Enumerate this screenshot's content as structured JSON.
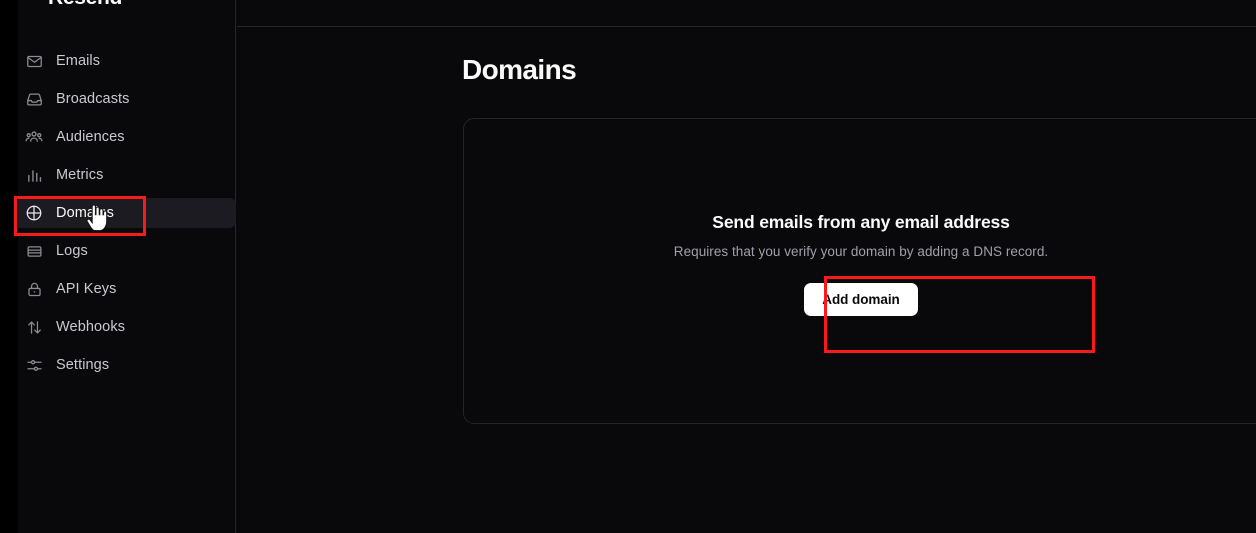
{
  "app": {
    "brand": "Resend",
    "background_color": "#09090b",
    "accent_color": "#ffffff",
    "annotation_color": "#f91b1b"
  },
  "sidebar": {
    "items": [
      {
        "label": "Emails",
        "icon": "envelope-icon",
        "active": false
      },
      {
        "label": "Broadcasts",
        "icon": "inbox-tray-icon",
        "active": false
      },
      {
        "label": "Audiences",
        "icon": "users-group-icon",
        "active": false
      },
      {
        "label": "Metrics",
        "icon": "bar-chart-icon",
        "active": false
      },
      {
        "label": "Domains",
        "icon": "globe-icon",
        "active": true
      },
      {
        "label": "Logs",
        "icon": "logs-icon",
        "active": false
      },
      {
        "label": "API Keys",
        "icon": "lock-icon",
        "active": false
      },
      {
        "label": "Webhooks",
        "icon": "arrows-updown-icon",
        "active": false
      },
      {
        "label": "Settings",
        "icon": "sliders-icon",
        "active": false
      }
    ]
  },
  "main": {
    "page_title": "Domains",
    "empty_state": {
      "title": "Send emails from any email address",
      "subtitle": "Requires that you verify your domain by adding a DNS record.",
      "button_label": "Add domain"
    }
  },
  "cursor": {
    "type": "pointer-hand-cursor"
  }
}
